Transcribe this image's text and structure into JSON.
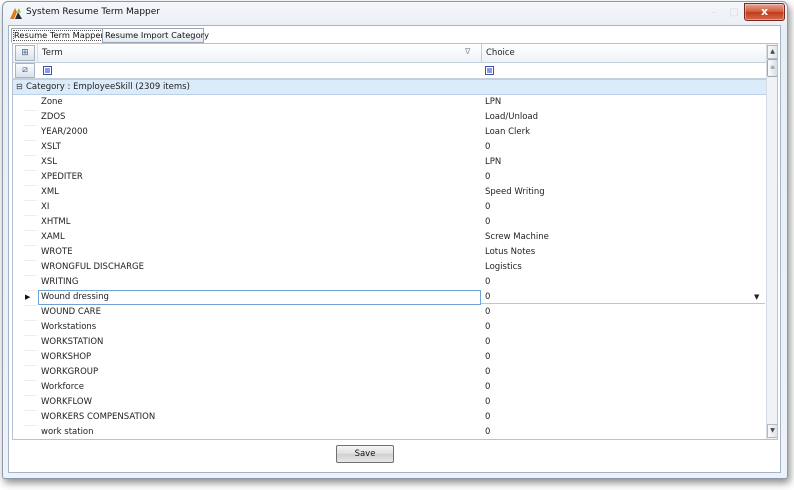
{
  "window": {
    "title": "System Resume Term Mapper",
    "close_label": "x",
    "min_label": "–",
    "max_label": "□"
  },
  "tabs": [
    {
      "label": "Resume Term Mapper"
    },
    {
      "label": "Resume Import Category"
    }
  ],
  "grid": {
    "columns": {
      "term": "Term",
      "choice": "Choice"
    },
    "group_label": "Category : EmployeeSkill (2309 items)",
    "rows": [
      {
        "term": "Zone",
        "choice": "LPN"
      },
      {
        "term": "ZDOS",
        "choice": "Load/Unload"
      },
      {
        "term": "YEAR/2000",
        "choice": "Loan Clerk"
      },
      {
        "term": "XSLT",
        "choice": "0"
      },
      {
        "term": "XSL",
        "choice": "LPN"
      },
      {
        "term": "XPEDITER",
        "choice": "0"
      },
      {
        "term": "XML",
        "choice": "Speed Writing"
      },
      {
        "term": "XI",
        "choice": "0"
      },
      {
        "term": "XHTML",
        "choice": "0"
      },
      {
        "term": "XAML",
        "choice": "Screw Machine"
      },
      {
        "term": "WROTE",
        "choice": "Lotus Notes"
      },
      {
        "term": "WRONGFUL DISCHARGE",
        "choice": "Logistics"
      },
      {
        "term": "WRITING",
        "choice": "0"
      },
      {
        "term": "Wound dressing",
        "choice": "0"
      },
      {
        "term": "WOUND CARE",
        "choice": "0"
      },
      {
        "term": "Workstations",
        "choice": "0"
      },
      {
        "term": "WORKSTATION",
        "choice": "0"
      },
      {
        "term": "WORKSHOP",
        "choice": "0"
      },
      {
        "term": "WORKGROUP",
        "choice": "0"
      },
      {
        "term": "Workforce",
        "choice": "0"
      },
      {
        "term": "WORKFLOW",
        "choice": "0"
      },
      {
        "term": "WORKERS COMPENSATION",
        "choice": "0"
      },
      {
        "term": "work station",
        "choice": "0"
      }
    ]
  },
  "footer": {
    "save_label": "Save"
  },
  "colors": {
    "group_bg": "#dcebf9",
    "focus_border": "#6ea3d8",
    "close_red": "#c03b1c"
  },
  "icons": [
    "app-logo-icon",
    "column-chooser-icon",
    "filter-clear-icon",
    "filter-funnel-icon",
    "expand-collapse-icon",
    "row-indicator-icon",
    "dropdown-arrow-icon"
  ]
}
